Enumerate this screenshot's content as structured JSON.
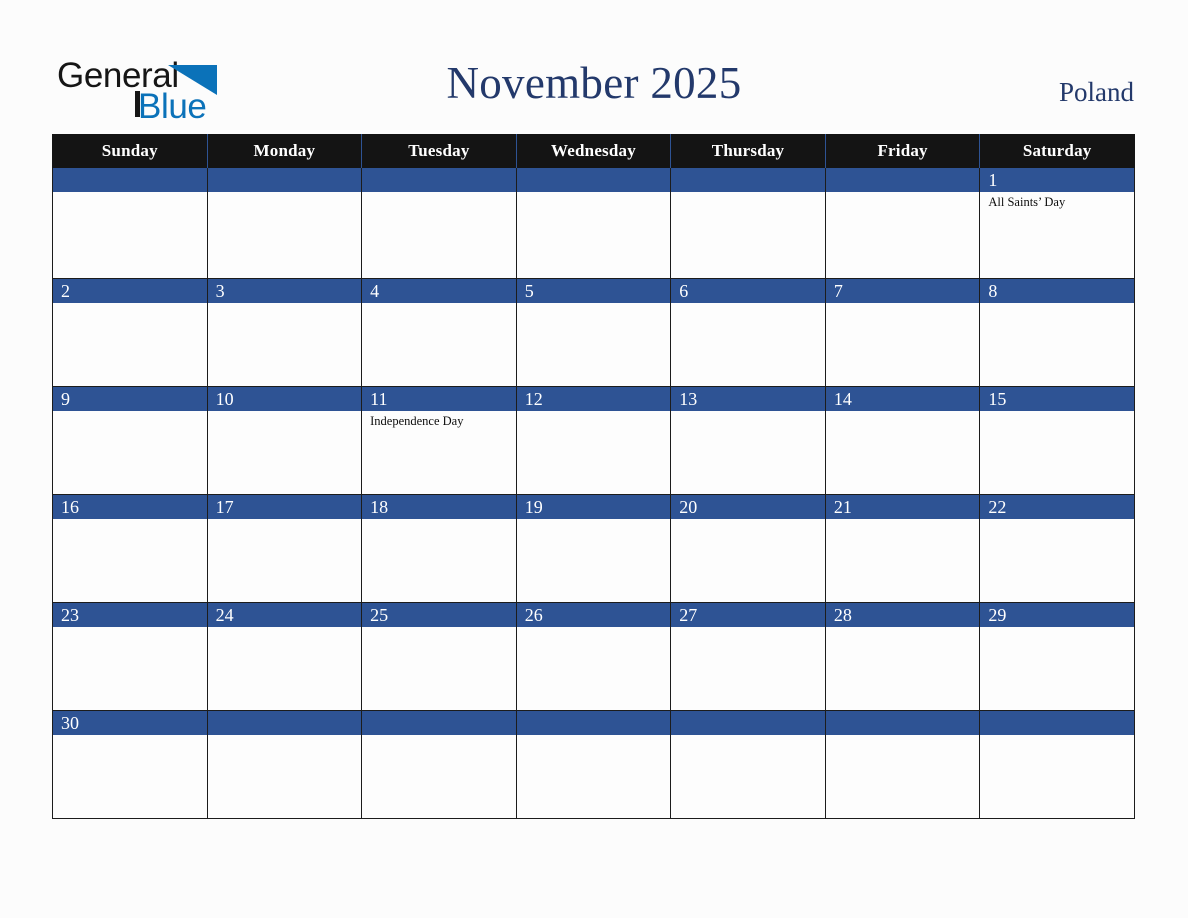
{
  "brand": {
    "name_part1": "General",
    "name_part2": "Blue",
    "triangle_color": "#0b72b9",
    "text_color": "#161616"
  },
  "header": {
    "title": "November 2025",
    "country": "Poland",
    "title_color": "#23396b"
  },
  "theme": {
    "page_background": "#fcfcfc",
    "header_row_background": "#141414",
    "date_bar_background": "#2e5394",
    "date_text_color": "#ffffff",
    "cell_background": "#fdfdfd",
    "grid_line_color": "#1c1c1c"
  },
  "calendar": {
    "month": "November",
    "year": "2025",
    "weekday_headers": [
      "Sunday",
      "Monday",
      "Tuesday",
      "Wednesday",
      "Thursday",
      "Friday",
      "Saturday"
    ],
    "weeks": [
      [
        {
          "day": "",
          "events": []
        },
        {
          "day": "",
          "events": []
        },
        {
          "day": "",
          "events": []
        },
        {
          "day": "",
          "events": []
        },
        {
          "day": "",
          "events": []
        },
        {
          "day": "",
          "events": []
        },
        {
          "day": "1",
          "events": [
            "All Saints’ Day"
          ]
        }
      ],
      [
        {
          "day": "2",
          "events": []
        },
        {
          "day": "3",
          "events": []
        },
        {
          "day": "4",
          "events": []
        },
        {
          "day": "5",
          "events": []
        },
        {
          "day": "6",
          "events": []
        },
        {
          "day": "7",
          "events": []
        },
        {
          "day": "8",
          "events": []
        }
      ],
      [
        {
          "day": "9",
          "events": []
        },
        {
          "day": "10",
          "events": []
        },
        {
          "day": "11",
          "events": [
            "Independence Day"
          ]
        },
        {
          "day": "12",
          "events": []
        },
        {
          "day": "13",
          "events": []
        },
        {
          "day": "14",
          "events": []
        },
        {
          "day": "15",
          "events": []
        }
      ],
      [
        {
          "day": "16",
          "events": []
        },
        {
          "day": "17",
          "events": []
        },
        {
          "day": "18",
          "events": []
        },
        {
          "day": "19",
          "events": []
        },
        {
          "day": "20",
          "events": []
        },
        {
          "day": "21",
          "events": []
        },
        {
          "day": "22",
          "events": []
        }
      ],
      [
        {
          "day": "23",
          "events": []
        },
        {
          "day": "24",
          "events": []
        },
        {
          "day": "25",
          "events": []
        },
        {
          "day": "26",
          "events": []
        },
        {
          "day": "27",
          "events": []
        },
        {
          "day": "28",
          "events": []
        },
        {
          "day": "29",
          "events": []
        }
      ],
      [
        {
          "day": "30",
          "events": []
        },
        {
          "day": "",
          "events": []
        },
        {
          "day": "",
          "events": []
        },
        {
          "day": "",
          "events": []
        },
        {
          "day": "",
          "events": []
        },
        {
          "day": "",
          "events": []
        },
        {
          "day": "",
          "events": []
        }
      ]
    ]
  }
}
